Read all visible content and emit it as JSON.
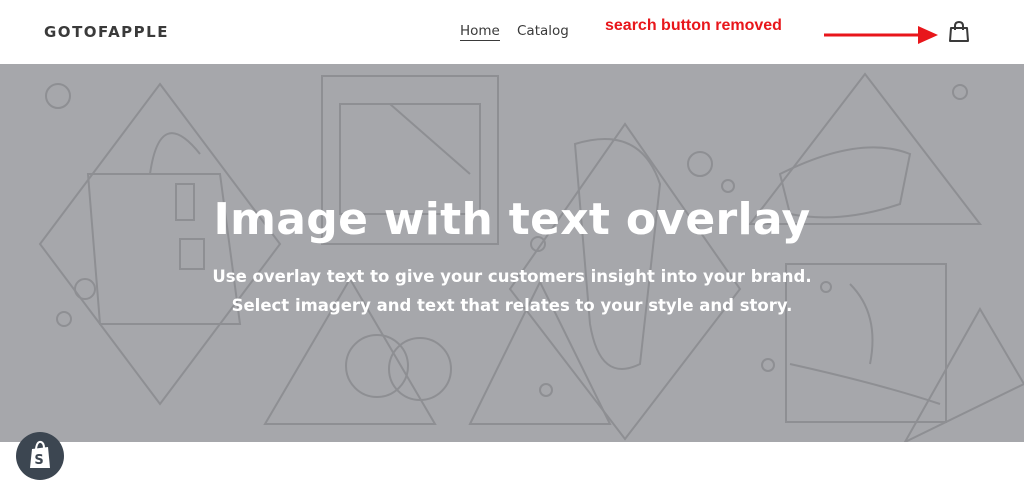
{
  "header": {
    "logo": "GOTOFAPPLE",
    "nav": [
      {
        "label": "Home",
        "active": true
      },
      {
        "label": "Catalog",
        "active": false
      }
    ],
    "annotation": "search button removed",
    "annotation_color": "#e8161b",
    "cart_icon": "shopping-bag-icon"
  },
  "hero": {
    "title": "Image with text overlay",
    "subtitle_lines": [
      "Use overlay text to give your customers insight into your brand.",
      "Select imagery and text that relates to your style and story."
    ],
    "background_color": "#a6a7ab"
  },
  "badge": {
    "icon": "shopify-bag-icon",
    "color": "#3c4651"
  }
}
